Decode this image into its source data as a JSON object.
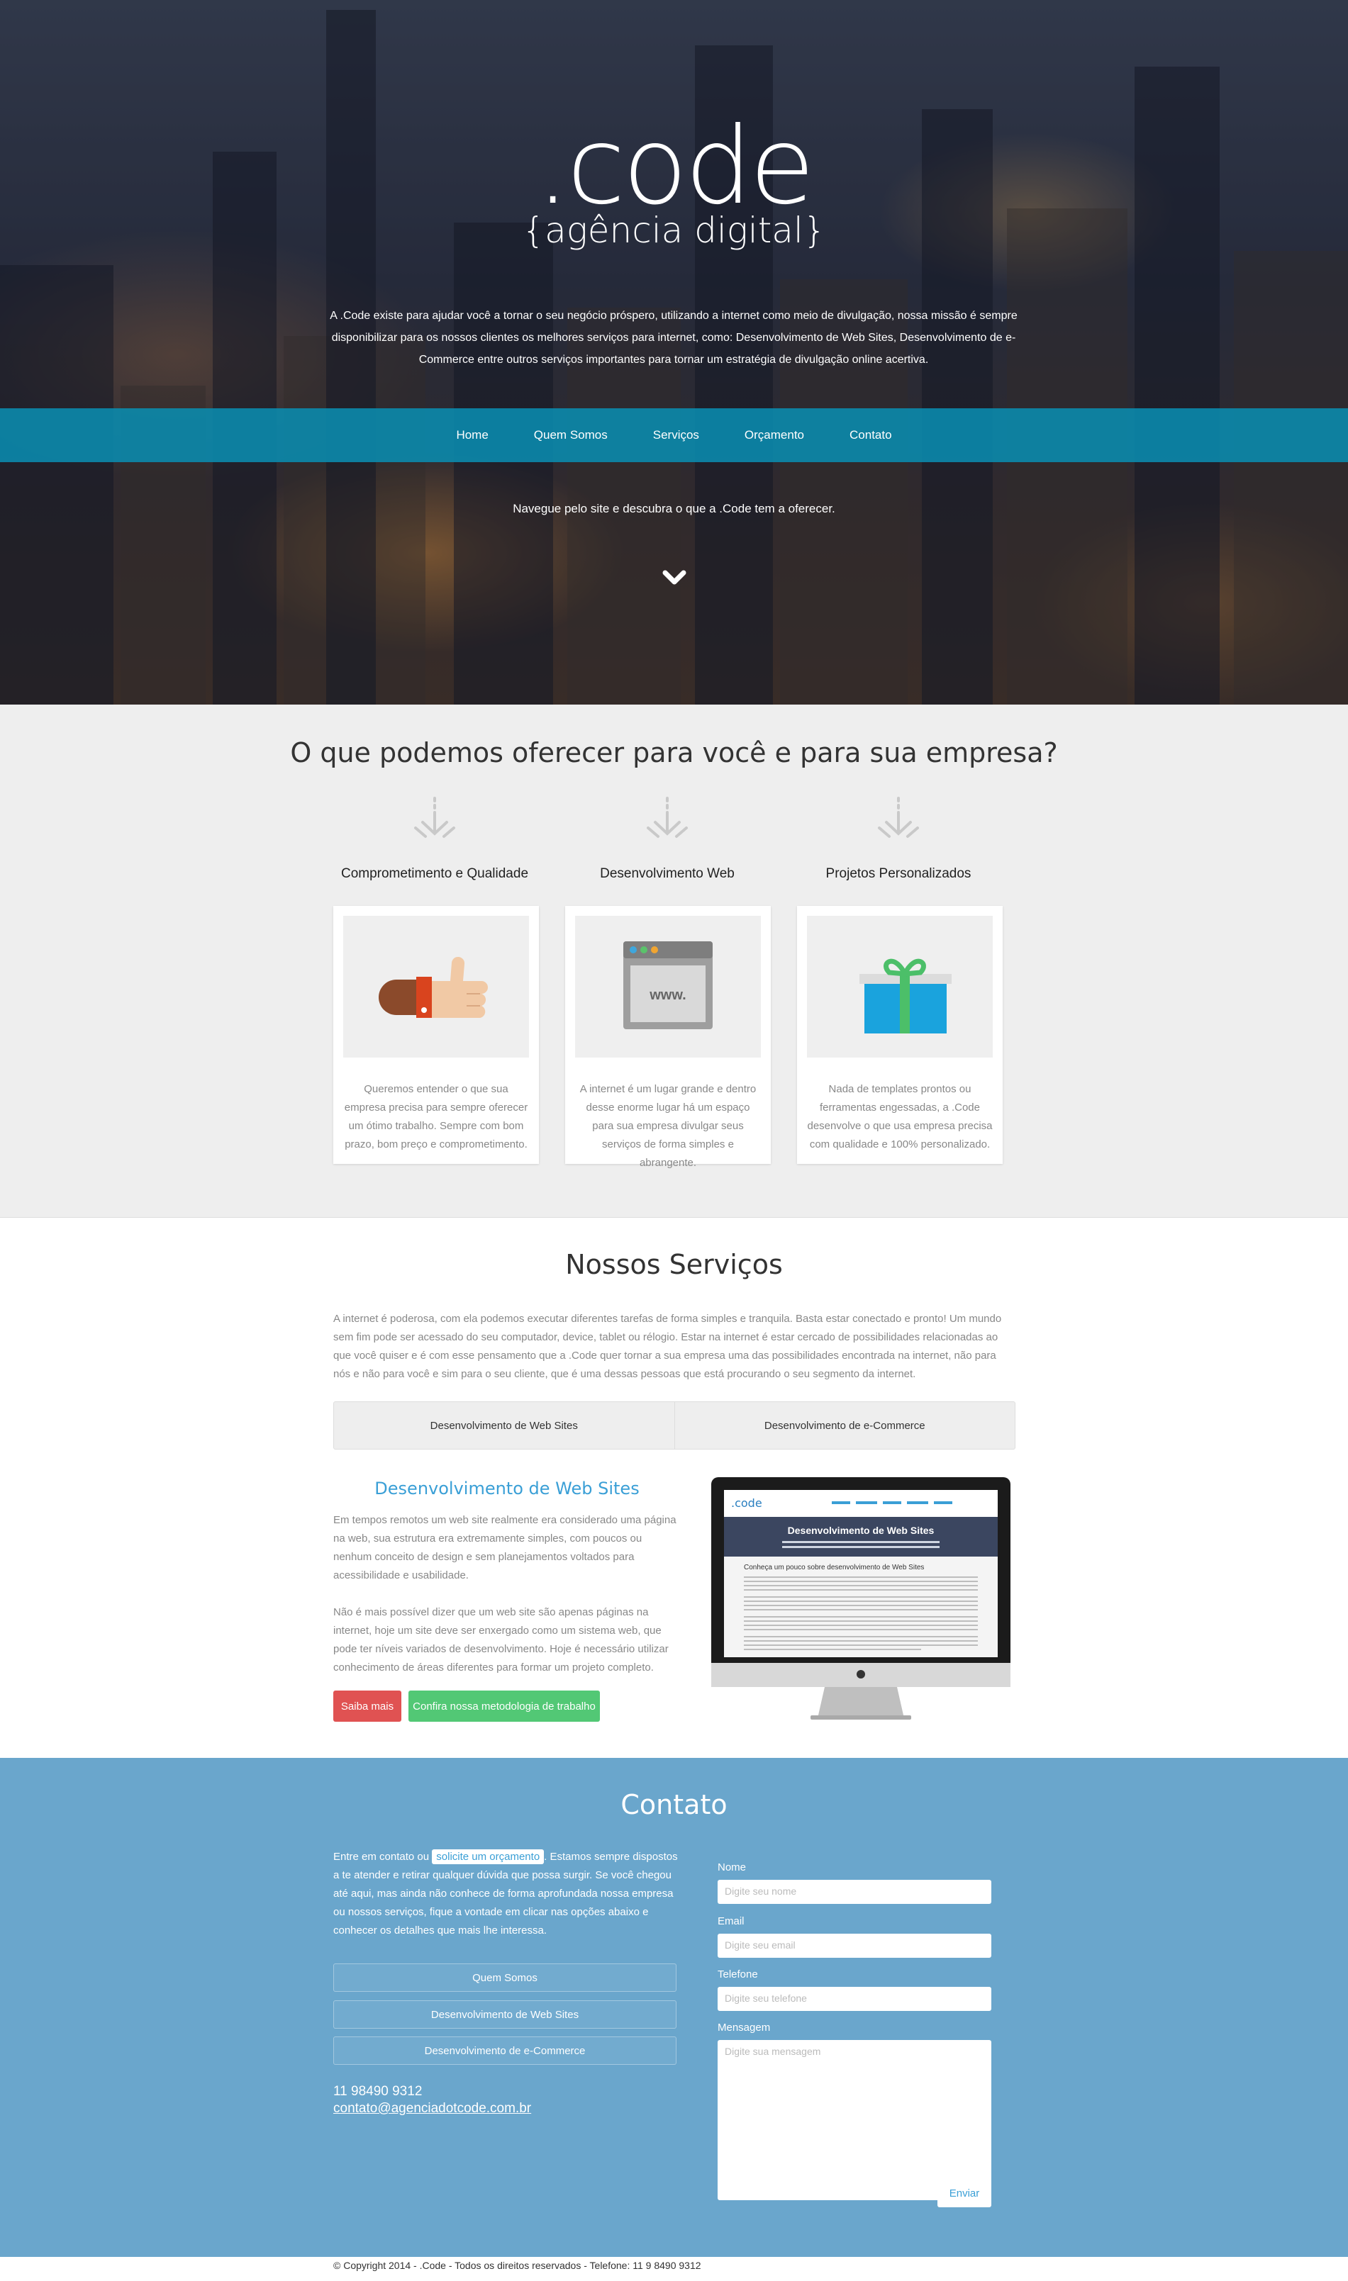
{
  "hero": {
    "logo": ".code",
    "tagline": "{agência digital}",
    "description": "A .Code existe para ajudar você a tornar o seu negócio próspero, utilizando a internet como meio de divulgação, nossa missão é sempre disponibilizar para os nossos clientes os melhores serviços para internet, como: Desenvolvimento de Web Sites, Desenvolvimento de e-Commerce entre outros serviços importantes para tornar um estratégia de divulgação online acertiva.",
    "cta": "Navegue pelo site e descubra o que a .Code tem a oferecer."
  },
  "nav": {
    "items": [
      "Home",
      "Quem Somos",
      "Serviços",
      "Orçamento",
      "Contato"
    ]
  },
  "offer": {
    "title": "O que podemos oferecer para você e para sua empresa?",
    "columns": [
      {
        "title": "Comprometimento e Qualidade",
        "icon": "thumbs-up-icon",
        "text": "Queremos entender o que sua empresa precisa para sempre oferecer um ótimo trabalho. Sempre com bom prazo, bom preço e comprometimento."
      },
      {
        "title": "Desenvolvimento Web",
        "icon": "browser-www-icon",
        "text": "A internet é um lugar grande e dentro desse enorme lugar há um espaço para sua empresa divulgar seus serviços de forma simples e abrangente.",
        "icon_text": "www."
      },
      {
        "title": "Projetos Personalizados",
        "icon": "gift-icon",
        "text": "Nada de templates prontos ou ferramentas engessadas, a .Code desenvolve o que usa empresa precisa com qualidade e 100% personalizado."
      }
    ]
  },
  "services": {
    "title": "Nossos Serviços",
    "intro": "A internet é poderosa, com ela podemos executar diferentes tarefas de forma simples e tranquila. Basta estar conectado e pronto! Um mundo sem fim pode ser acessado do seu computador, device, tablet ou rélogio. Estar na internet é estar cercado de possibilidades relacionadas ao que você quiser e é com esse pensamento que a .Code quer tornar a sua empresa uma das possibilidades encontrada na internet, não para nós e não para você e sim para o seu cliente, que é uma dessas pessoas que está procurando o seu segmento da internet.",
    "tabs": [
      "Desenvolvimento de Web Sites",
      "Desenvolvimento de e-Commerce"
    ],
    "active_title": "Desenvolvimento de Web Sites",
    "p1": "Em tempos remotos um web site realmente era considerado uma página na web, sua estrutura era extremamente simples, com poucos ou nenhum conceito de design e sem planejamentos voltados para acessibilidade e usabilidade.",
    "p2": "Não é mais possível dizer que um web site são apenas páginas na internet, hoje um site deve ser enxergado como um sistema web, que pode ter níveis variados de desenvolvimento. Hoje é necessário utilizar conhecimento de áreas diferentes para formar um projeto completo.",
    "btn_more": "Saiba mais",
    "btn_method": "Confira nossa metodologia de trabalho",
    "screen": {
      "logo": ".code",
      "title": "Desenvolvimento de Web Sites",
      "subtitle": "Conheça um pouco sobre desenvolvimento de Web Sites"
    }
  },
  "contact": {
    "title": "Contato",
    "text_before": "Entre em contato ou",
    "text_link": "solicite um orçamento",
    "text_after": ". Estamos sempre dispostos a te atender e retirar qualquer dúvida que possa surgir. Se você chegou até aqui, mas ainda não conhece de forma aprofundada nossa empresa ou nossos serviços, fique a vontade em clicar nas opções abaixo e conhecer os detalhes que mais lhe interessa.",
    "links": [
      "Quem Somos",
      "Desenvolvimento de Web Sites",
      "Desenvolvimento de e-Commerce"
    ],
    "phone": "11 98490 9312",
    "email": "contato@agenciadotcode.com.br",
    "form": {
      "name_label": "Nome",
      "name_ph": "Digite seu nome",
      "email_label": "Email",
      "email_ph": "Digite seu email",
      "phone_label": "Telefone",
      "phone_ph": "Digite seu telefone",
      "msg_label": "Mensagem",
      "msg_ph": "Digite sua mensagem",
      "submit": "Enviar"
    }
  },
  "footer": {
    "text": "© Copyright 2014 - .Code - Todos os direitos reservados - Telefone: 11 9 8490 9312"
  },
  "colors": {
    "nav": "#0a8caf",
    "contact_bg": "#6aa6cc",
    "accent_blue": "#3a9fd6",
    "btn_red": "#e05252",
    "btn_green": "#52c875"
  }
}
